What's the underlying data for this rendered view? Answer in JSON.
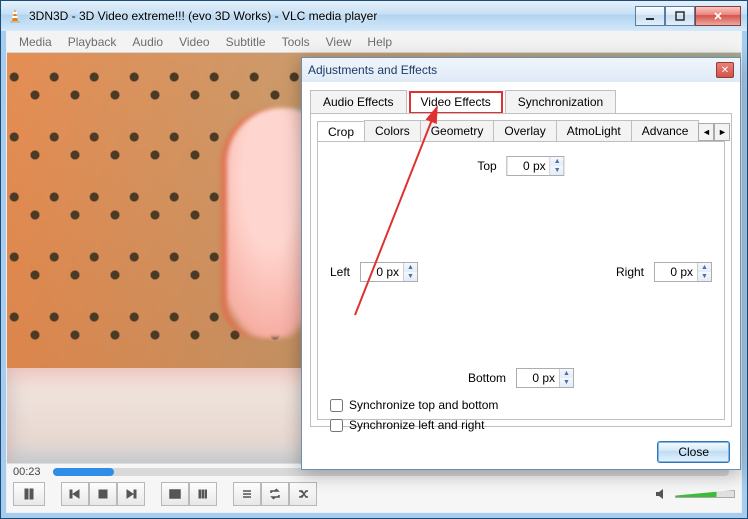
{
  "window": {
    "title": "3DN3D - 3D Video extreme!!! (evo 3D Works) - VLC media player"
  },
  "menu": {
    "media": "Media",
    "playback": "Playback",
    "audio": "Audio",
    "video": "Video",
    "subtitle": "Subtitle",
    "tools": "Tools",
    "view": "View",
    "help": "Help"
  },
  "player": {
    "elapsed": "00:23"
  },
  "dialog": {
    "title": "Adjustments and Effects",
    "outer_tabs": {
      "audio": "Audio Effects",
      "video": "Video Effects",
      "sync": "Synchronization"
    },
    "inner_tabs": {
      "crop": "Crop",
      "colors": "Colors",
      "geometry": "Geometry",
      "overlay": "Overlay",
      "atmo": "AtmoLight",
      "advanced": "Advance"
    },
    "crop": {
      "top_label": "Top",
      "top_value": "0 px",
      "left_label": "Left",
      "left_value": "0 px",
      "right_label": "Right",
      "right_value": "0 px",
      "bottom_label": "Bottom",
      "bottom_value": "0 px",
      "sync_tb": "Synchronize top and bottom",
      "sync_lr": "Synchronize left and right"
    },
    "close": "Close"
  }
}
